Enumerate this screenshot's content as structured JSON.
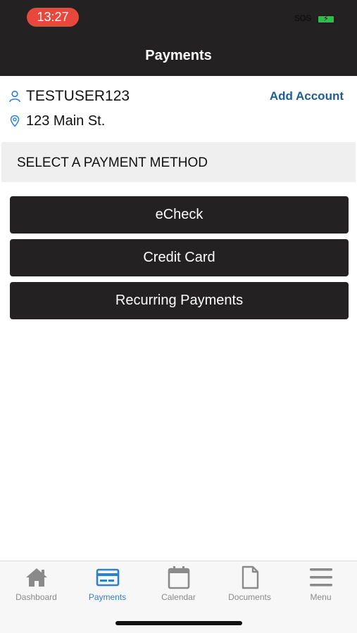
{
  "status_bar": {
    "time": "13:27",
    "sos": "SOS"
  },
  "header": {
    "title": "Payments"
  },
  "account": {
    "username": "TESTUSER123",
    "address": "123 Main St.",
    "add_account_label": "Add Account"
  },
  "section": {
    "title": "SELECT A PAYMENT METHOD"
  },
  "methods": [
    {
      "label": "eCheck"
    },
    {
      "label": "Credit Card"
    },
    {
      "label": "Recurring Payments"
    }
  ],
  "tabs": [
    {
      "label": "Dashboard",
      "icon": "home-icon"
    },
    {
      "label": "Payments",
      "icon": "credit-card-icon"
    },
    {
      "label": "Calendar",
      "icon": "calendar-icon"
    },
    {
      "label": "Documents",
      "icon": "document-icon"
    },
    {
      "label": "Menu",
      "icon": "hamburger-menu-icon"
    }
  ],
  "active_tab": "Payments",
  "colors": {
    "header_bg": "#232122",
    "time_pill": "#e8473b",
    "link": "#1f5d92",
    "active_tab": "#2f80d1",
    "inactive_tab": "#8a8a8a"
  }
}
